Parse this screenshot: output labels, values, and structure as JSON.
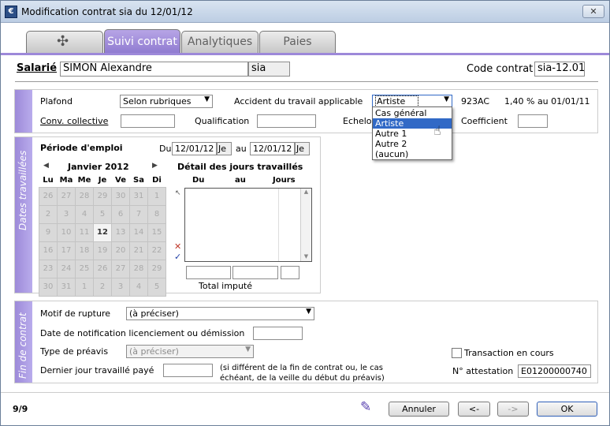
{
  "window": {
    "title": "Modification contrat sia du 12/01/12",
    "close": "✕",
    "app_icon": "€"
  },
  "tabs": [
    {
      "label": ""
    },
    {
      "label": "Suivi contrat",
      "active": true
    },
    {
      "label": "Analytiques"
    },
    {
      "label": "Paies"
    }
  ],
  "header": {
    "salarie_label": "Salarié",
    "salarie_value": "SIMON Alexandre",
    "salarie_code": "sia",
    "code_contrat_label": "Code contrat",
    "code_contrat_value": "sia-12.01"
  },
  "general": {
    "plafond_label": "Plafond",
    "plafond_value": "Selon rubriques",
    "accident_label": "Accident du travail applicable",
    "accident_value": "Artiste",
    "accident_code": "923AC",
    "accident_rate": "1,40 % au 01/01/11",
    "conv_label": "Conv. collective",
    "qualification_label": "Qualification",
    "echelon_label": "Echelo",
    "coefficient_label": "Coefficient"
  },
  "accident_options": [
    "Cas général",
    "Artiste",
    "Autre 1",
    "Autre 2",
    "(aucun)"
  ],
  "dates": {
    "side_label": "Dates travaillées",
    "periode_label": "Période d'emploi",
    "du_label": "Du",
    "du_value": "12/01/12",
    "du_day": "Je",
    "au_label": "au",
    "au_value": "12/01/12",
    "au_day": "Je",
    "month_label": "Janvier 2012",
    "weekdays": [
      "Lu",
      "Ma",
      "Me",
      "Je",
      "Ve",
      "Sa",
      "Di"
    ],
    "calendar": [
      [
        "26",
        "27",
        "28",
        "29",
        "30",
        "31",
        "1"
      ],
      [
        "2",
        "3",
        "4",
        "5",
        "6",
        "7",
        "8"
      ],
      [
        "9",
        "10",
        "11",
        "12",
        "13",
        "14",
        "15"
      ],
      [
        "16",
        "17",
        "18",
        "19",
        "20",
        "21",
        "22"
      ],
      [
        "23",
        "24",
        "25",
        "26",
        "27",
        "28",
        "29"
      ],
      [
        "30",
        "31",
        "1",
        "2",
        "3",
        "4",
        "5"
      ]
    ],
    "selected_day": "12",
    "detail_title": "Détail des jours travaillés",
    "col_du": "Du",
    "col_au": "au",
    "col_jours": "Jours",
    "total_label": "Total imputé",
    "prev": "◀",
    "next": "▶"
  },
  "fin": {
    "side_label": "Fin de contrat",
    "motif_label": "Motif de rupture",
    "motif_value": "(à préciser)",
    "notif_label": "Date de notification licenciement ou démission",
    "preavis_label": "Type de préavis",
    "preavis_value": "(à préciser)",
    "dernier_label": "Dernier jour travaillé payé",
    "dernier_note_1": "(si différent de la fin de contrat ou, le cas",
    "dernier_note_2": "échéant, de la veille du début du préavis)",
    "transaction_label": "Transaction en cours",
    "attestation_label": "N° attestation",
    "attestation_value": "E01200000740"
  },
  "footer": {
    "pager": "9/9",
    "annuler": "Annuler",
    "prev": "<-",
    "next": "->",
    "ok": "OK"
  }
}
